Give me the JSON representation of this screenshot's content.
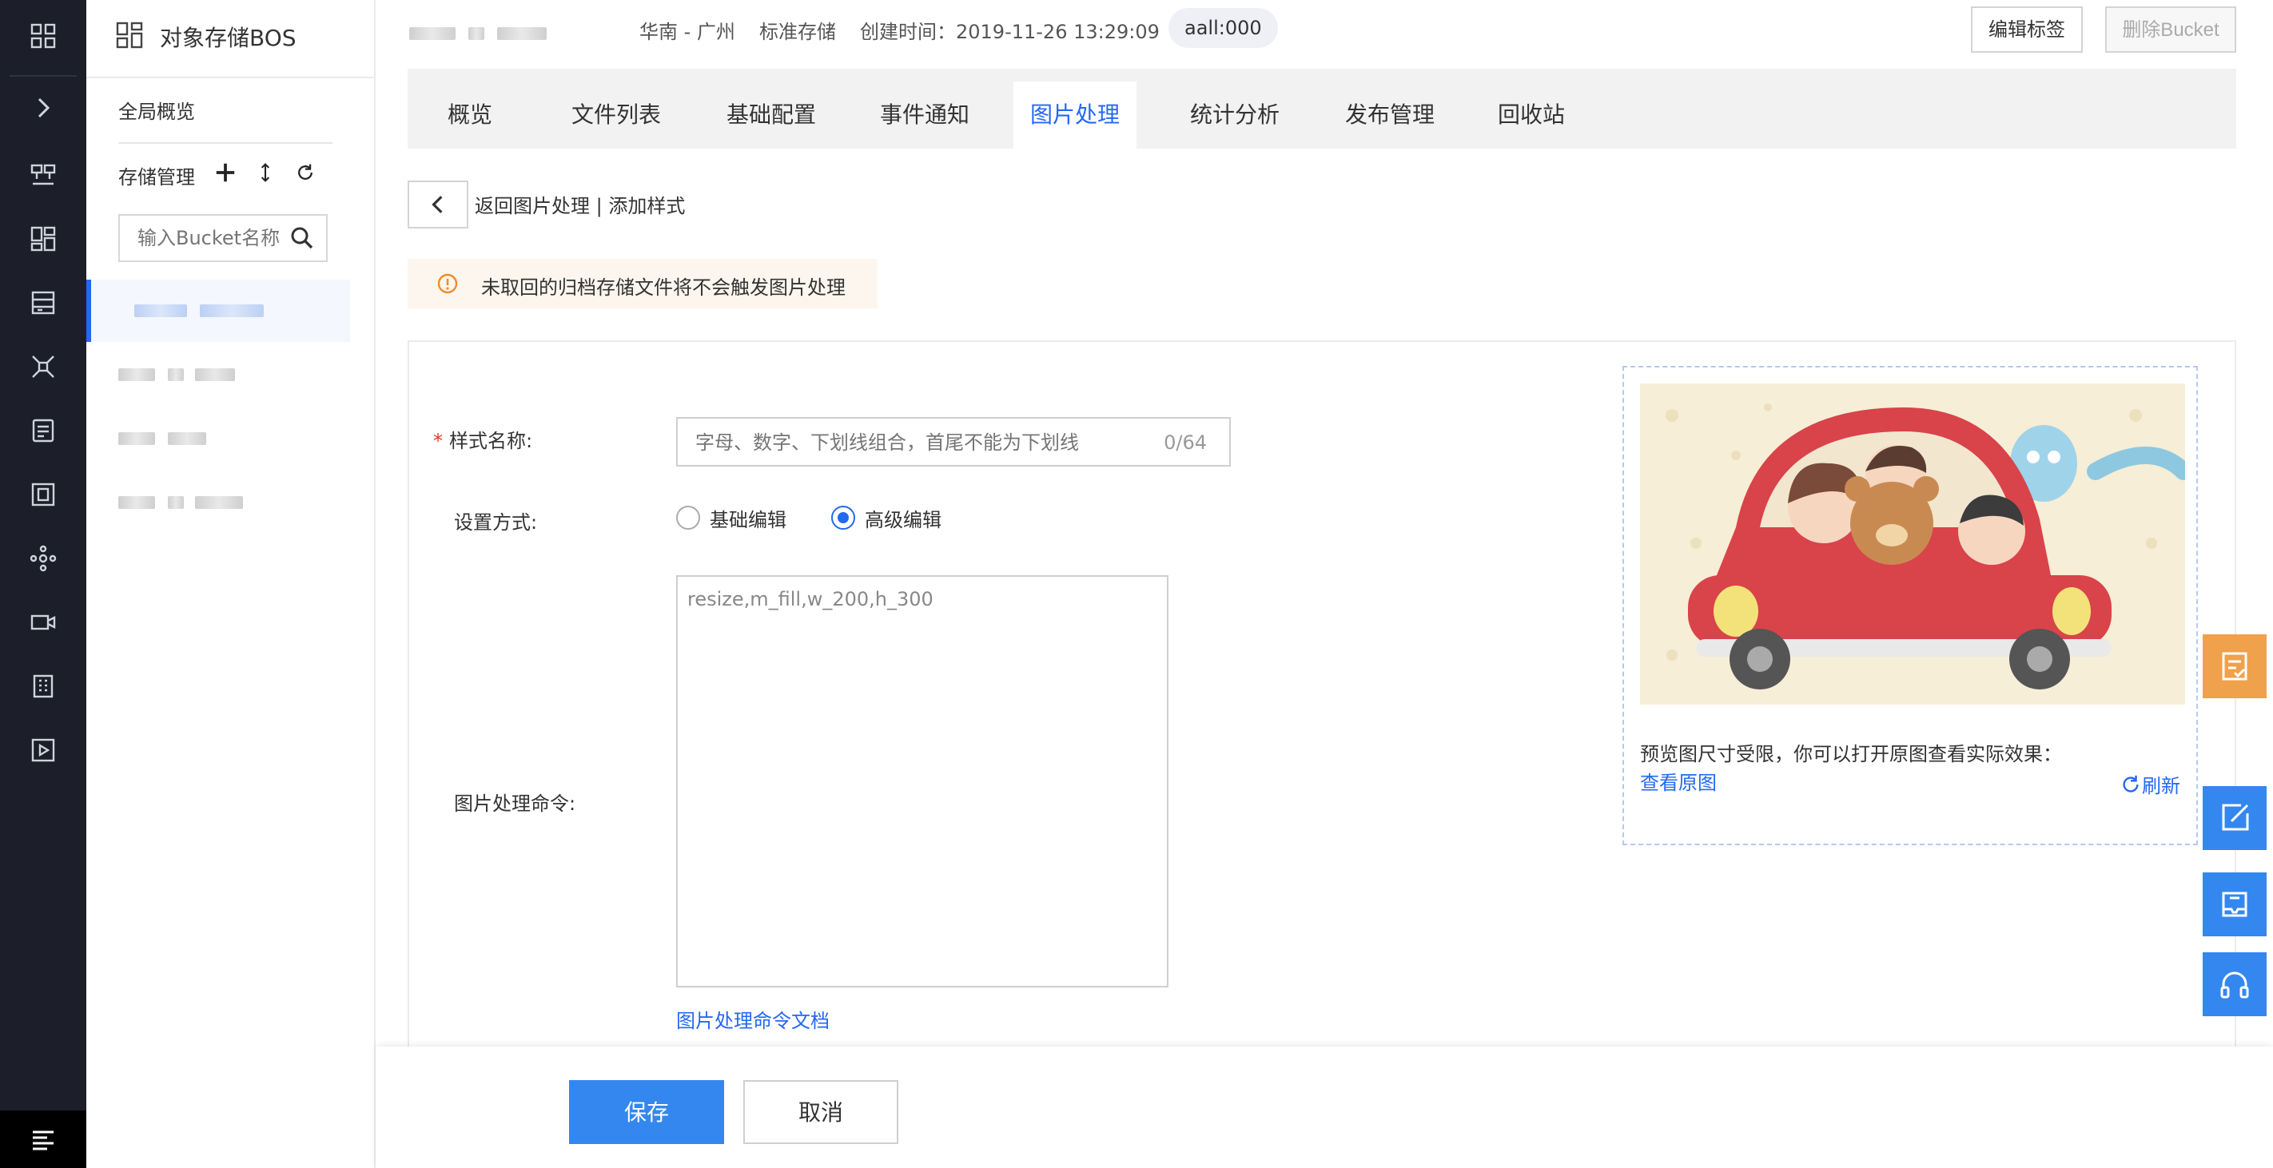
{
  "subnav": {
    "title": "对象存储BOS",
    "overview": "全局概览",
    "storage_mgmt": "存储管理",
    "search_placeholder": "输入Bucket名称"
  },
  "header": {
    "region": "华南 - 广州",
    "storage_class": "标准存储",
    "created": "创建时间：2019-11-26 13:29:09",
    "tag": "aall:000",
    "edit_tag": "编辑标签",
    "delete_bucket": "删除Bucket"
  },
  "tabs": [
    {
      "label": "概览"
    },
    {
      "label": "文件列表"
    },
    {
      "label": "基础配置"
    },
    {
      "label": "事件通知"
    },
    {
      "label": "图片处理",
      "active": true
    },
    {
      "label": "统计分析"
    },
    {
      "label": "发布管理"
    },
    {
      "label": "回收站"
    }
  ],
  "breadcrumb": "返回图片处理 | 添加样式",
  "notice": "未取回的归档存储文件将不会触发图片处理",
  "form": {
    "name_label": "样式名称:",
    "name_required_mark": "*",
    "name_placeholder": "字母、数字、下划线组合，首尾不能为下划线",
    "name_count": "0/64",
    "mode_label": "设置方式:",
    "mode_basic": "基础编辑",
    "mode_advanced": "高级编辑",
    "mode_selected": "高级编辑",
    "cmd_label": "图片处理命令:",
    "cmd_value": "resize,m_fill,w_200,h_300",
    "cmd_doc": "图片处理命令文档"
  },
  "preview": {
    "text": "预览图尺寸受限，你可以打开原图查看实际效果：",
    "link": "查看原图",
    "refresh": "刷新"
  },
  "footer": {
    "save": "保存",
    "cancel": "取消"
  },
  "colors": {
    "accent": "#2468f2",
    "float_orange": "#f0a14b",
    "float_blue": "#3487ee",
    "rail": "#1c1f29"
  }
}
